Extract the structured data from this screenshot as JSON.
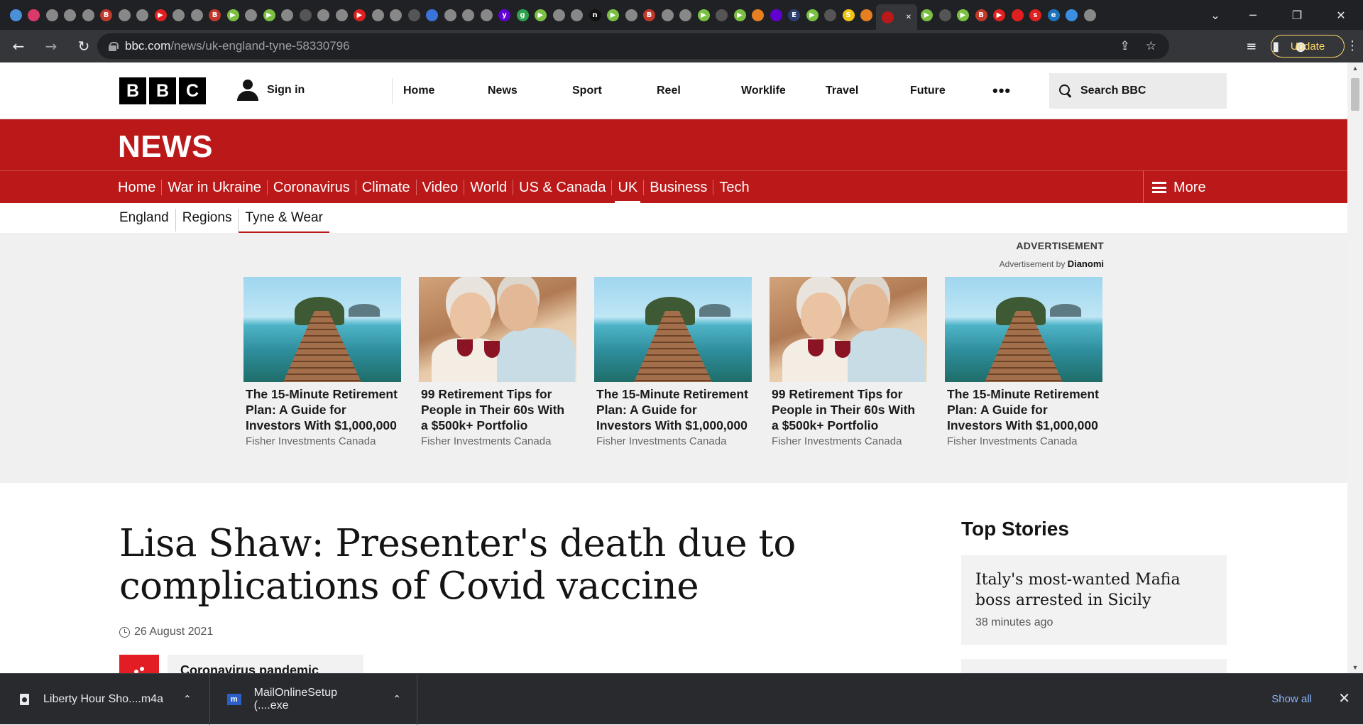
{
  "browser": {
    "tab_favicons": [
      {
        "icon": "globe-icon",
        "color": "#4a90d9",
        "glyph": ""
      },
      {
        "icon": "flower-icon",
        "color": "#d93a6a",
        "glyph": ""
      },
      {
        "icon": "globe-icon",
        "color": "#888888",
        "glyph": ""
      },
      {
        "icon": "globe-icon",
        "color": "#888888",
        "glyph": ""
      },
      {
        "icon": "globe-icon",
        "color": "#888888",
        "glyph": ""
      },
      {
        "icon": "bi-icon",
        "color": "#c0392b",
        "glyph": "B"
      },
      {
        "icon": "globe-icon",
        "color": "#888888",
        "glyph": ""
      },
      {
        "icon": "globe-icon",
        "color": "#888888",
        "glyph": ""
      },
      {
        "icon": "youtube-icon",
        "color": "#e02020",
        "glyph": "▶"
      },
      {
        "icon": "globe-icon",
        "color": "#888888",
        "glyph": ""
      },
      {
        "icon": "globe-icon",
        "color": "#888888",
        "glyph": ""
      },
      {
        "icon": "bi-icon",
        "color": "#c0392b",
        "glyph": "B"
      },
      {
        "icon": "rumble-icon",
        "color": "#7bc043",
        "glyph": "▶"
      },
      {
        "icon": "globe-icon",
        "color": "#888888",
        "glyph": ""
      },
      {
        "icon": "rumble-icon",
        "color": "#7bc043",
        "glyph": "▶"
      },
      {
        "icon": "globe-icon",
        "color": "#888888",
        "glyph": ""
      },
      {
        "icon": "bookmark-icon",
        "color": "#555555",
        "glyph": ""
      },
      {
        "icon": "globe-icon",
        "color": "#888888",
        "glyph": ""
      },
      {
        "icon": "globe-icon",
        "color": "#888888",
        "glyph": ""
      },
      {
        "icon": "youtube-icon",
        "color": "#e02020",
        "glyph": "▶"
      },
      {
        "icon": "globe-icon",
        "color": "#888888",
        "glyph": ""
      },
      {
        "icon": "globe-icon",
        "color": "#888888",
        "glyph": ""
      },
      {
        "icon": "bookmark-icon",
        "color": "#555555",
        "glyph": ""
      },
      {
        "icon": "search-icon",
        "color": "#3b74d8",
        "glyph": ""
      },
      {
        "icon": "globe-icon",
        "color": "#888888",
        "glyph": ""
      },
      {
        "icon": "globe-icon",
        "color": "#888888",
        "glyph": ""
      },
      {
        "icon": "globe-icon",
        "color": "#888888",
        "glyph": ""
      },
      {
        "icon": "yahoo-icon",
        "color": "#6001d2",
        "glyph": "y"
      },
      {
        "icon": "g-icon",
        "color": "#2ca24c",
        "glyph": "g"
      },
      {
        "icon": "rumble-icon",
        "color": "#7bc043",
        "glyph": "▶"
      },
      {
        "icon": "globe-icon",
        "color": "#888888",
        "glyph": ""
      },
      {
        "icon": "globe-icon",
        "color": "#888888",
        "glyph": ""
      },
      {
        "icon": "n-icon",
        "color": "#111111",
        "glyph": "n"
      },
      {
        "icon": "rumble-icon",
        "color": "#7bc043",
        "glyph": "▶"
      },
      {
        "icon": "globe-icon",
        "color": "#888888",
        "glyph": ""
      },
      {
        "icon": "bi-icon",
        "color": "#c0392b",
        "glyph": "B"
      },
      {
        "icon": "globe-icon",
        "color": "#888888",
        "glyph": ""
      },
      {
        "icon": "globe-icon",
        "color": "#888888",
        "glyph": ""
      },
      {
        "icon": "rumble-icon",
        "color": "#7bc043",
        "glyph": "▶"
      },
      {
        "icon": "bookmark-icon",
        "color": "#555555",
        "glyph": ""
      },
      {
        "icon": "rumble-icon",
        "color": "#7bc043",
        "glyph": "▶"
      },
      {
        "icon": "flag-icon",
        "color": "#e67e22",
        "glyph": ""
      },
      {
        "icon": "yahoo-icon",
        "color": "#6001d2",
        "glyph": ""
      },
      {
        "icon": "ei-icon",
        "color": "#2c3e70",
        "glyph": "E"
      },
      {
        "icon": "rumble-icon",
        "color": "#7bc043",
        "glyph": "▶"
      },
      {
        "icon": "bookmark-icon",
        "color": "#555555",
        "glyph": ""
      },
      {
        "icon": "s-icon",
        "color": "#f1c40f",
        "glyph": "S"
      },
      {
        "icon": "sun-icon",
        "color": "#e67e22",
        "glyph": ""
      },
      {
        "icon": "rumble-icon",
        "color": "#7bc043",
        "glyph": "▶"
      },
      {
        "icon": "bookmark-icon",
        "color": "#555555",
        "glyph": ""
      },
      {
        "icon": "rumble-icon",
        "color": "#7bc043",
        "glyph": "▶"
      },
      {
        "icon": "bi-icon",
        "color": "#c0392b",
        "glyph": "B"
      },
      {
        "icon": "youtube-icon",
        "color": "#e02020",
        "glyph": "▶"
      },
      {
        "icon": "pin-icon",
        "color": "#e02020",
        "glyph": ""
      },
      {
        "icon": "s-icon",
        "color": "#e02020",
        "glyph": "s"
      },
      {
        "icon": "e-icon",
        "color": "#1e73be",
        "glyph": "e"
      },
      {
        "icon": "cloud-icon",
        "color": "#3b8ee0",
        "glyph": ""
      },
      {
        "icon": "globe-icon",
        "color": "#888888",
        "glyph": ""
      }
    ],
    "active_tab_icon": "bbc-icon",
    "url_host": "bbc.com",
    "url_path": "/news/uk-england-tyne-58330796",
    "update_label": "Update"
  },
  "masthead": {
    "logo_letters": [
      "B",
      "B",
      "C"
    ],
    "signin_label": "Sign in",
    "nav": [
      "Home",
      "News",
      "Sport",
      "Reel",
      "Worklife",
      "Travel",
      "Future"
    ],
    "more_label": "•••",
    "search_label": "Search BBC"
  },
  "news": {
    "banner": "NEWS",
    "nav": [
      "Home",
      "War in Ukraine",
      "Coronavirus",
      "Climate",
      "Video",
      "World",
      "US & Canada",
      "UK",
      "Business",
      "Tech"
    ],
    "current": "UK",
    "more_label": "More",
    "subnav": [
      "England",
      "Regions",
      "Tyne & Wear"
    ],
    "subnav_current": "Tyne & Wear"
  },
  "ad": {
    "label": "ADVERTISEMENT",
    "by_prefix": "Advertisement by",
    "by_brand": "Dianomi",
    "cards": [
      {
        "image": "pier",
        "title": "The 15-Minute Retirement Plan: A Guide for Investors With $1,000,000",
        "source": "Fisher Investments Canada"
      },
      {
        "image": "couple",
        "title": "99 Retirement Tips for People in Their 60s With a $500k+ Portfolio",
        "source": "Fisher Investments Canada"
      },
      {
        "image": "pier",
        "title": "The 15-Minute Retirement Plan: A Guide for Investors With $1,000,000",
        "source": "Fisher Investments Canada"
      },
      {
        "image": "couple",
        "title": "99 Retirement Tips for People in Their 60s With a $500k+ Portfolio",
        "source": "Fisher Investments Canada"
      },
      {
        "image": "pier",
        "title": "The 15-Minute Retirement Plan: A Guide for Investors With $1,000,000",
        "source": "Fisher Investments Canada"
      }
    ]
  },
  "article": {
    "headline": "Lisa Shaw: Presenter's death due to complications of Covid vaccine",
    "date": "26 August 2021",
    "topic": "Coronavirus pandemic"
  },
  "top_stories": {
    "title": "Top Stories",
    "items": [
      {
        "title": "Italy's most-wanted Mafia boss arrested in Sicily",
        "time": "38 minutes ago"
      }
    ]
  },
  "downloads": {
    "items": [
      {
        "name": "Liberty Hour Sho....m4a",
        "icon": "file-icon"
      },
      {
        "name": "MailOnlineSetup (....exe",
        "icon": "app-icon"
      }
    ],
    "show_all": "Show all"
  }
}
